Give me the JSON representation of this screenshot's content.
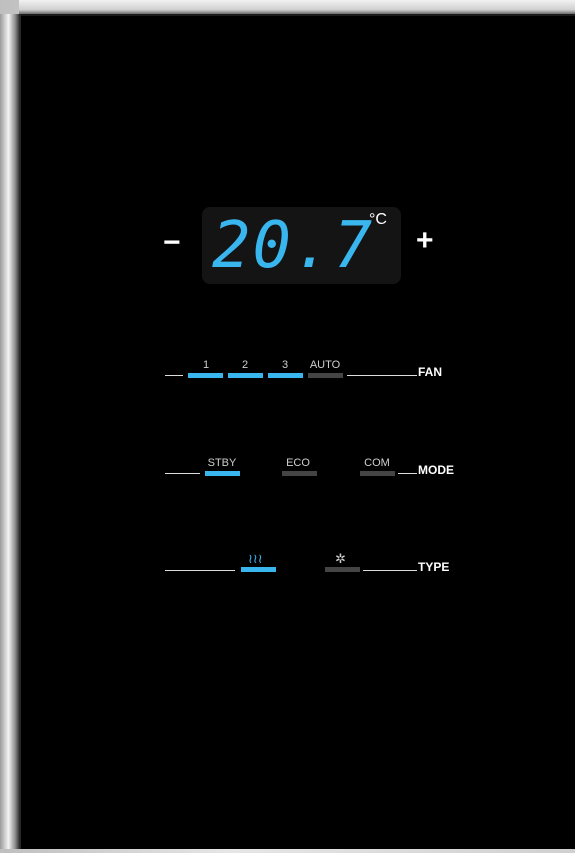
{
  "display": {
    "decrease_label": "−",
    "increase_label": "+",
    "temperature": "20.7",
    "unit": "°C"
  },
  "fan": {
    "label": "FAN",
    "options": [
      {
        "label": "1",
        "active": true
      },
      {
        "label": "2",
        "active": true
      },
      {
        "label": "3",
        "active": true
      },
      {
        "label": "AUTO",
        "active": false
      }
    ]
  },
  "mode": {
    "label": "MODE",
    "options": [
      {
        "label": "STBY",
        "active": true
      },
      {
        "label": "ECO",
        "active": false
      },
      {
        "label": "COM",
        "active": false
      }
    ]
  },
  "type": {
    "label": "TYPE",
    "options": [
      {
        "icon": "heat-icon",
        "glyph": "≀≀≀",
        "active": true
      },
      {
        "icon": "cool-icon",
        "glyph": "✲",
        "active": false
      }
    ]
  },
  "colors": {
    "active": "#3ab6ef",
    "inactive": "#444444",
    "panel": "#000000"
  }
}
